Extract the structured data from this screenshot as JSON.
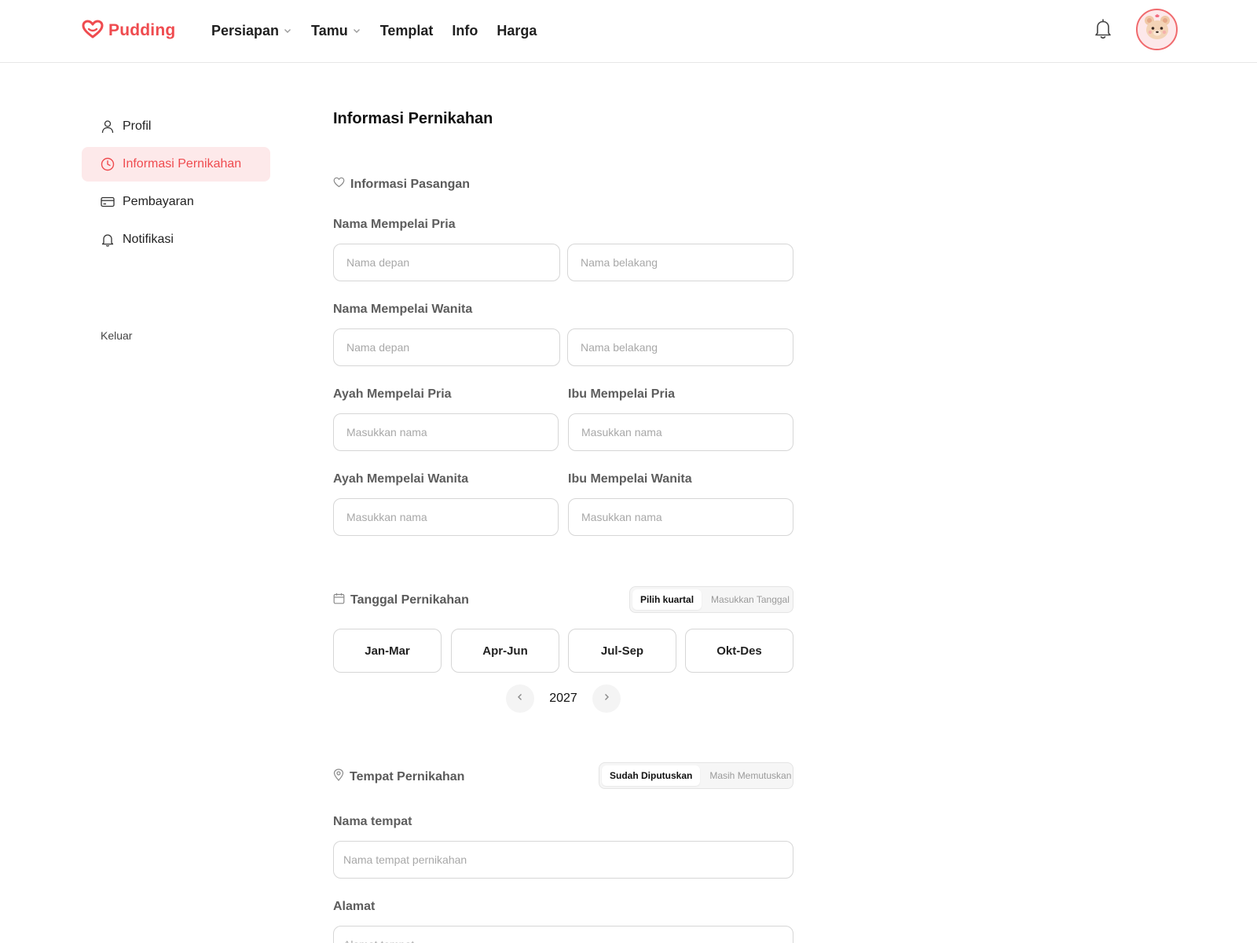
{
  "header": {
    "brand": "Pudding",
    "nav": [
      {
        "label": "Persiapan",
        "has_dropdown": true
      },
      {
        "label": "Tamu",
        "has_dropdown": true
      },
      {
        "label": "Templat",
        "has_dropdown": false
      },
      {
        "label": "Info",
        "has_dropdown": false
      },
      {
        "label": "Harga",
        "has_dropdown": false
      }
    ],
    "icons": {
      "notification": "bell-icon",
      "avatar": "bear-avatar"
    }
  },
  "sidebar": {
    "items": [
      {
        "label": "Profil",
        "icon": "user-icon",
        "active": false
      },
      {
        "label": "Informasi Pernikahan",
        "icon": "clock-icon",
        "active": true
      },
      {
        "label": "Pembayaran",
        "icon": "credit-card-icon",
        "active": false
      },
      {
        "label": "Notifikasi",
        "icon": "bell-icon",
        "active": false
      }
    ],
    "logout": "Keluar"
  },
  "main": {
    "title": "Informasi Pernikahan",
    "couple": {
      "heading": "Informasi Pasangan",
      "groom_label": "Nama Mempelai Pria",
      "bride_label": "Nama Mempelai Wanita",
      "first_name_placeholder": "Nama depan",
      "last_name_placeholder": "Nama belakang",
      "groom_father_label": "Ayah Mempelai Pria",
      "groom_mother_label": "Ibu Mempelai Pria",
      "bride_father_label": "Ayah Mempelai Wanita",
      "bride_mother_label": "Ibu Mempelai Wanita",
      "name_placeholder": "Masukkan nama"
    },
    "date": {
      "heading": "Tanggal Pernikahan",
      "toggle": [
        "Pilih kuartal",
        "Masukkan Tanggal"
      ],
      "toggle_selected": "Pilih kuartal",
      "quarters": [
        "Jan-Mar",
        "Apr-Jun",
        "Jul-Sep",
        "Okt-Des"
      ],
      "year": "2027"
    },
    "venue": {
      "heading": "Tempat Pernikahan",
      "toggle": [
        "Sudah Diputuskan",
        "Masih Memutuskan"
      ],
      "toggle_selected": "Sudah Diputuskan",
      "place_label": "Nama tempat",
      "place_placeholder": "Nama tempat pernikahan",
      "address_label": "Alamat",
      "address_placeholder": "Alamat tempat"
    }
  },
  "colors": {
    "accent": "#ef4b4f",
    "active_bg": "#fde9ea",
    "border": "#d6d6d6"
  }
}
